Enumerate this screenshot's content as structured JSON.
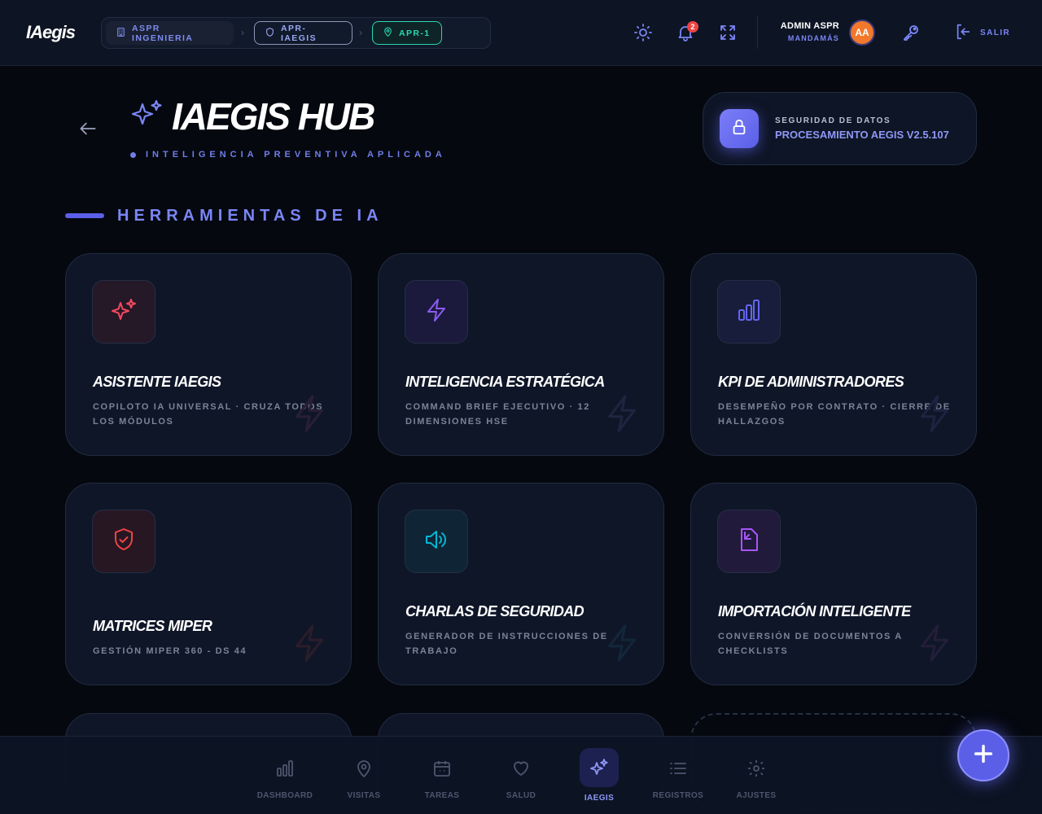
{
  "app": {
    "logo": "IAegis"
  },
  "breadcrumb": [
    {
      "label": "ASPR INGENIERIA",
      "icon": "building-icon"
    },
    {
      "label": "APR-IAEGIS",
      "icon": "shield-icon"
    },
    {
      "label": "APR-1",
      "icon": "map-pin-icon"
    }
  ],
  "topbar": {
    "notification_count": "2",
    "user_name": "ADMIN ASPR",
    "user_role": "MANDAMÁS",
    "avatar_initials": "AA",
    "logout_label": "SALIR"
  },
  "header": {
    "title": "IAEGIS HUB",
    "subtitle": "INTELIGENCIA PREVENTIVA APLICADA"
  },
  "security": {
    "label": "SEGURIDAD DE DATOS",
    "value": "PROCESAMIENTO AEGIS V2.5.107"
  },
  "section_title": "HERRAMIENTAS DE IA",
  "tools": [
    {
      "title": "ASISTENTE IAEGIS",
      "description": "COPILOTO IA UNIVERSAL · CRUZA TODOS LOS MÓDULOS",
      "icon": "sparkles-icon",
      "color": "#f0485e"
    },
    {
      "title": "INTELIGENCIA ESTRATÉGICA",
      "description": "COMMAND BRIEF EJECUTIVO · 12 DIMENSIONES HSE",
      "icon": "lightning-icon",
      "color": "#8b5cf6"
    },
    {
      "title": "KPI DE ADMINISTRADORES",
      "description": "DESEMPEÑO POR CONTRATO · CIERRE DE HALLAZGOS",
      "icon": "bar-chart-icon",
      "color": "#6366f1"
    },
    {
      "title": "MATRICES MIPER",
      "description": "GESTIÓN MIPER 360 - DS 44",
      "icon": "shield-check-icon",
      "color": "#ef4444"
    },
    {
      "title": "CHARLAS DE SEGURIDAD",
      "description": "GENERADOR DE INSTRUCCIONES DE TRABAJO",
      "icon": "speaker-icon",
      "color": "#06b6d4"
    },
    {
      "title": "IMPORTACIÓN INTELIGENTE",
      "description": "CONVERSIÓN DE DOCUMENTOS A CHECKLISTS",
      "icon": "file-import-icon",
      "color": "#a855f7"
    }
  ],
  "bottom_nav": [
    {
      "label": "DASHBOARD",
      "icon": "bar-chart-icon",
      "active": false
    },
    {
      "label": "VISITAS",
      "icon": "map-pin-icon",
      "active": false
    },
    {
      "label": "TAREAS",
      "icon": "calendar-icon",
      "active": false
    },
    {
      "label": "SALUD",
      "icon": "heart-icon",
      "active": false
    },
    {
      "label": "IAEGIS",
      "icon": "sparkles-icon",
      "active": true
    },
    {
      "label": "REGISTROS",
      "icon": "list-icon",
      "active": false
    },
    {
      "label": "AJUSTES",
      "icon": "settings-icon",
      "active": false
    }
  ],
  "fab": {
    "icon": "plus-icon"
  }
}
